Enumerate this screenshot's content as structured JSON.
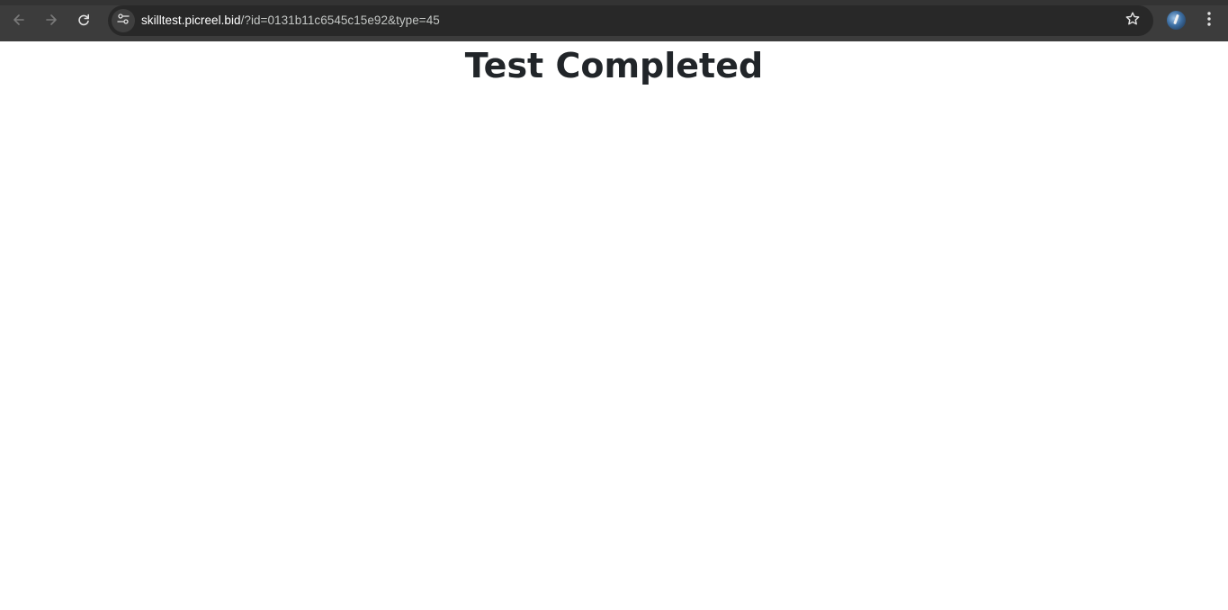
{
  "browser": {
    "url_host": "skilltest.picreel.bid",
    "url_path": "/?id=0131b11c6545c15e92&type=45",
    "icons": {
      "back": "arrow-left-icon",
      "forward": "arrow-right-icon",
      "reload": "reload-icon",
      "site_info": "tune-icon",
      "bookmark": "star-icon",
      "profile": "profile-avatar",
      "menu": "kebab-menu-icon"
    },
    "colors": {
      "toolbar": "#3c3c3c",
      "omnibox": "#282828",
      "url_host": "#ffffff",
      "url_path": "#c4c7c5"
    }
  },
  "page": {
    "title": "Test Completed",
    "title_color": "#212529",
    "background": "#ffffff"
  }
}
